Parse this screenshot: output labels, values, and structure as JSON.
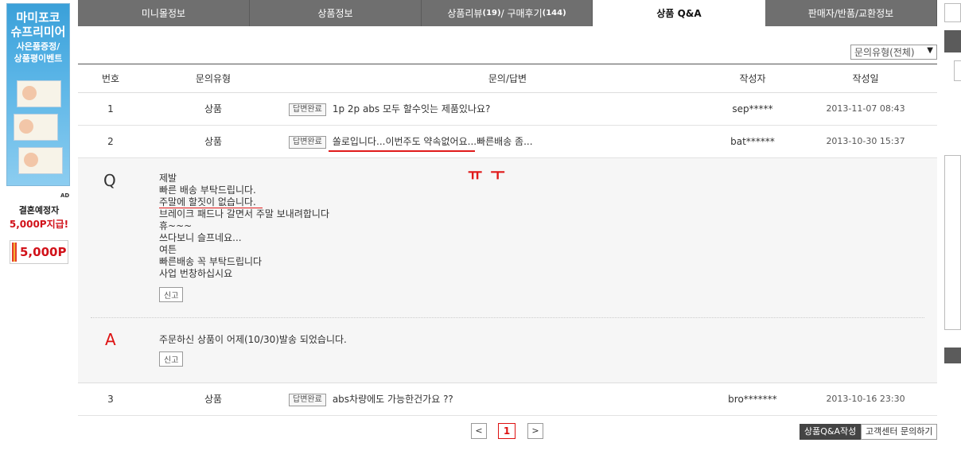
{
  "ad": {
    "title_line1": "마미포코",
    "title_line2": "슈프리미어",
    "sub_line1": "사은품증정/",
    "sub_line2": "상품평이벤트",
    "ad_mark": "AD",
    "promo_line1": "결혼예정자",
    "promo_line2": "5,000P지급!",
    "coupon_value": "5,000P"
  },
  "tabs": [
    {
      "label": "미니몰정보"
    },
    {
      "label": "상품정보"
    },
    {
      "label_prefix": "상품리뷰",
      "review_count": "(19)",
      "label_mid": " / 구매후기",
      "purchase_count": "(144)"
    },
    {
      "label": "상품 Q&A",
      "active": true
    },
    {
      "label": "판매자/반품/교환정보"
    }
  ],
  "filter": {
    "label": "문의유형(전체)",
    "arrow": "▼"
  },
  "table": {
    "headers": {
      "no": "번호",
      "type": "문의유형",
      "title": "문의/답변",
      "writer": "작성자",
      "date": "작성일"
    },
    "rows": [
      {
        "no": "1",
        "type": "상품",
        "badge": "답변완료",
        "title": "1p 2p abs 모두 할수잇는 제품있나요?",
        "writer": "sep*****",
        "date": "2013-11-07 08:43"
      },
      {
        "no": "2",
        "type": "상품",
        "badge": "답변완료",
        "title": "쏠로입니다...이번주도 약속없어요...빠른배송 좀...",
        "writer": "bat******",
        "date": "2013-10-30 15:37"
      },
      {
        "no": "3",
        "type": "상품",
        "badge": "답변완료",
        "title": "abs차량에도 가능한건가요 ??",
        "writer": "bro*******",
        "date": "2013-10-16 23:30"
      }
    ]
  },
  "detail": {
    "q_mark": "Q",
    "q_lines": [
      "제발",
      "빠른 배송 부탁드립니다.",
      "주말에 할짓이 없습니다.",
      "브레이크 패드나 갈면서 주말 보내려합니다",
      "휴~~~",
      "쓰다보니 슬프네요...",
      "여튼",
      "빠른배송 꼭 부탁드립니다",
      "사업 번창하십시요"
    ],
    "report_label": "신고",
    "a_mark": "A",
    "answer": "주문하신 상품이 어제(10/30)발송 되었습니다."
  },
  "pagination": {
    "prev": "<",
    "current": "1",
    "next": ">"
  },
  "buttons": {
    "write": "상품Q&A작성",
    "customer_center": "고객센터 문의하기"
  },
  "colors": {
    "tab_bg": "#6f6f6f",
    "accent_red": "#d11111",
    "annotation_red": "#e01a1a"
  }
}
